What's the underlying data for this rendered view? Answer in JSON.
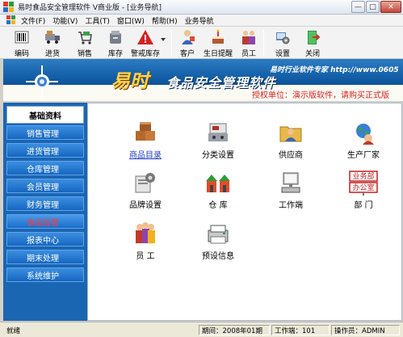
{
  "window": {
    "title": "易时食品安全管理软件 V商业版 - [业务导航]",
    "buttons": {
      "minimize": "—",
      "maximize": "□",
      "close": "✕"
    }
  },
  "menu": [
    "文件(F)",
    "功能(V)",
    "工具(T)",
    "窗口(W)",
    "帮助(H)",
    "业务导航"
  ],
  "toolbar": [
    {
      "label": "编码",
      "icon": "barcode-icon"
    },
    {
      "label": "进货",
      "icon": "truck-icon"
    },
    {
      "label": "销售",
      "icon": "shopping-cart-icon"
    },
    {
      "label": "库存",
      "icon": "storage-box-icon"
    },
    {
      "label": "警戒库存",
      "icon": "warning-icon"
    },
    {
      "label": "客户",
      "icon": "customer-icon"
    },
    {
      "label": "生日提醒",
      "icon": "birthday-cake-icon"
    },
    {
      "label": "员工",
      "icon": "staff-icon"
    },
    {
      "label": "设置",
      "icon": "settings-icon"
    },
    {
      "label": "关闭",
      "icon": "exit-door-icon"
    }
  ],
  "banner": {
    "brand": "易时",
    "title": "食品安全管理软件",
    "slogan": "易时行业软件专家 http://www.0605",
    "license": "授权单位：演示版软件，请购买正式版"
  },
  "sidebar": {
    "header": "基础资料",
    "items": [
      {
        "label": "销售管理",
        "active": false
      },
      {
        "label": "进货管理",
        "active": false
      },
      {
        "label": "仓库管理",
        "active": false
      },
      {
        "label": "会员管理",
        "active": false
      },
      {
        "label": "财务管理",
        "active": false
      },
      {
        "label": "食品监管",
        "active": true
      },
      {
        "label": "报表中心",
        "active": false
      },
      {
        "label": "期末处理",
        "active": false
      },
      {
        "label": "系统维护",
        "active": false
      }
    ]
  },
  "content": {
    "items": [
      {
        "label": "商品目录",
        "icon": "product-boxes-icon",
        "link": true
      },
      {
        "label": "分类设置",
        "icon": "category-scale-icon",
        "link": false
      },
      {
        "label": "供应商",
        "icon": "supplier-folder-icon",
        "link": false
      },
      {
        "label": "生产厂家",
        "icon": "manufacturer-globe-icon",
        "link": false
      },
      {
        "label": "品牌设置",
        "icon": "brand-gear-icon",
        "link": false
      },
      {
        "label": "仓  库",
        "icon": "warehouse-icon",
        "link": false
      },
      {
        "label": "工作端",
        "icon": "workstation-computer-icon",
        "link": false
      },
      {
        "label": "部  门",
        "icon": "department-sign-icon",
        "link": false,
        "sign": [
          "业务部",
          "办公室"
        ]
      },
      {
        "label": "员  工",
        "icon": "employees-icon",
        "link": false
      },
      {
        "label": "预设信息",
        "icon": "preset-info-icon",
        "link": false
      }
    ]
  },
  "status": {
    "ready": "就绪",
    "period": "期间：2008年01期",
    "terminal": "工作端：101",
    "operator": "操作员：ADMIN"
  },
  "colors": {
    "sidebar_bg": "#1b66b3",
    "nav_button": "#2a7ed4",
    "active_nav_text": "#ff3b3b",
    "banner_blue": "#0f5aa2",
    "brand_gold": "#ffd34a",
    "license_red": "#e02020"
  }
}
